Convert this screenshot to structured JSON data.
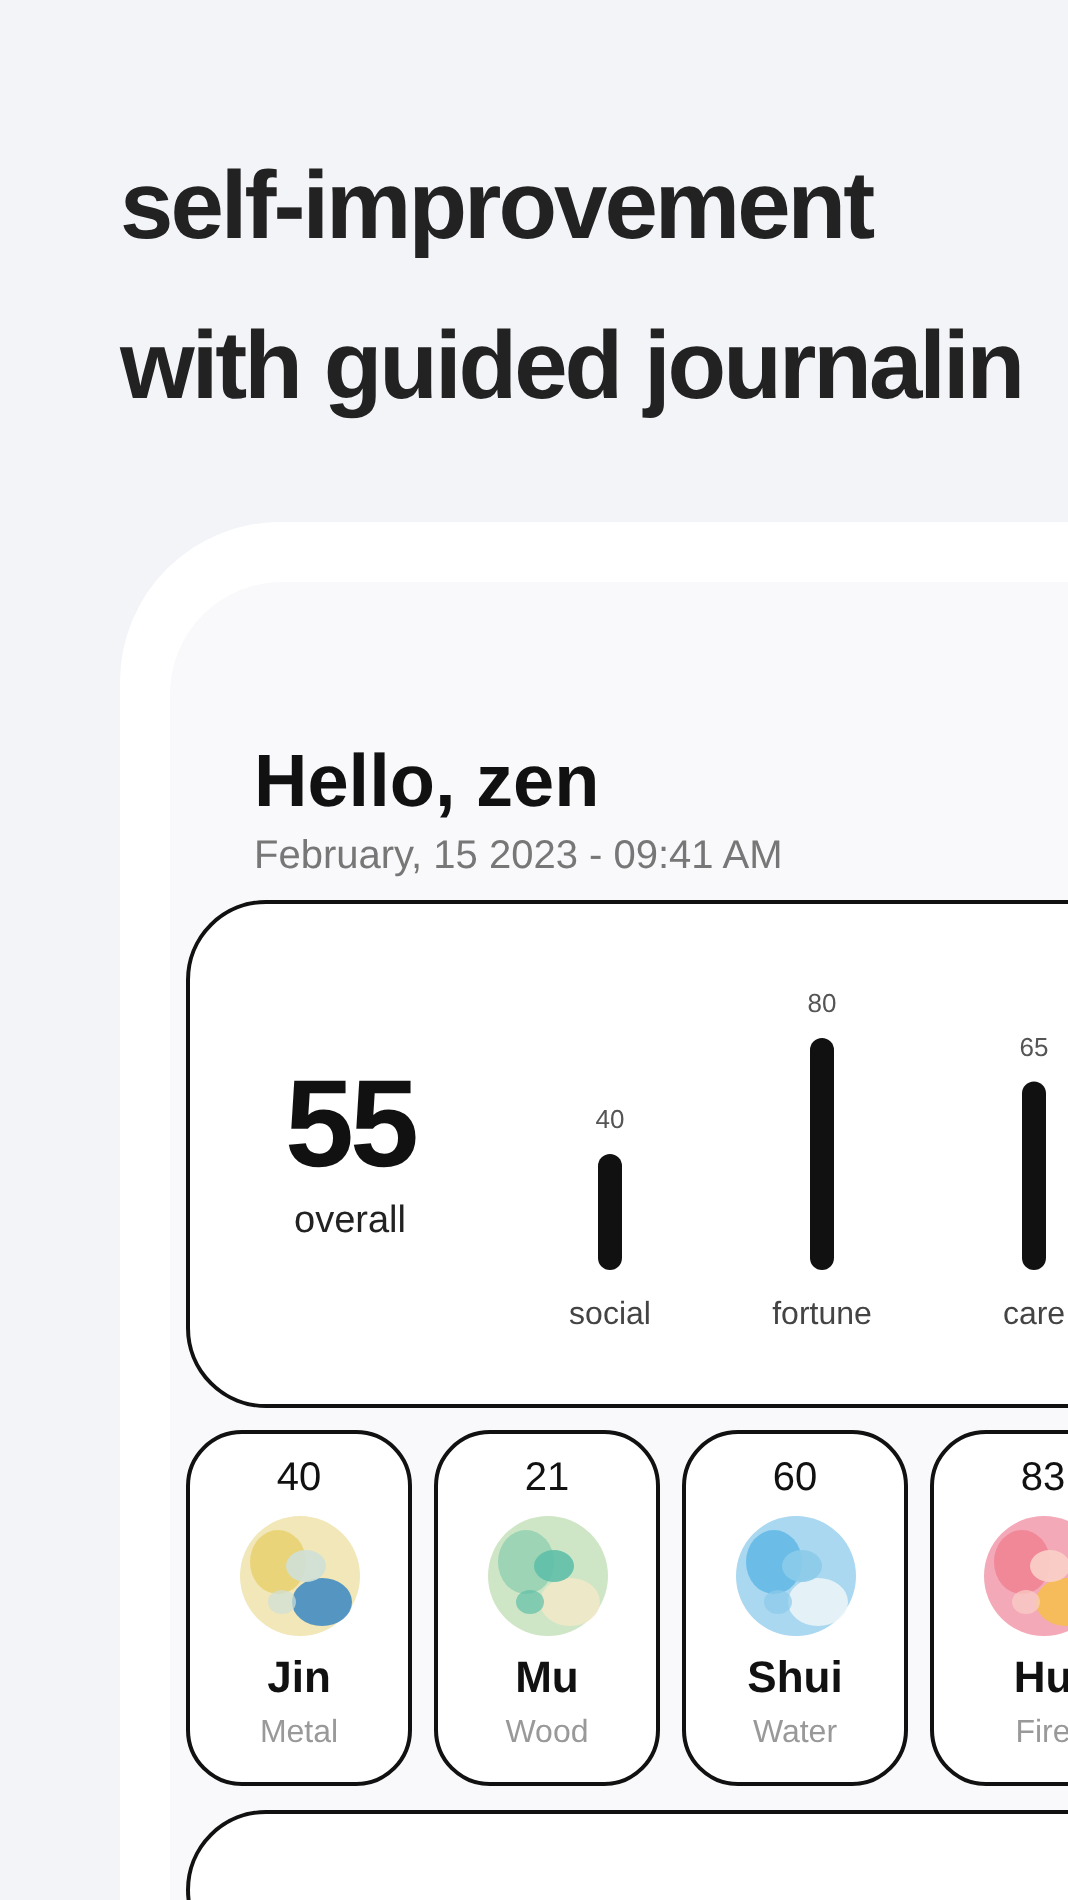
{
  "headline": [
    "self-improvement",
    "with guided journalin"
  ],
  "greeting": {
    "title": "Hello, zen",
    "date": "February, 15 2023 - 09:41 AM"
  },
  "score": {
    "value": "55",
    "label": "overall",
    "chart_data": {
      "type": "bar",
      "categories": [
        "social",
        "fortune",
        "care"
      ],
      "values": [
        40,
        80,
        65
      ],
      "data_labels": true
    }
  },
  "elements": [
    {
      "score": "40",
      "name": "Jin",
      "meaning": "Metal"
    },
    {
      "score": "21",
      "name": "Mu",
      "meaning": "Wood"
    },
    {
      "score": "60",
      "name": "Shui",
      "meaning": "Water"
    },
    {
      "score": "83",
      "name": "Hu",
      "meaning": "Fire"
    }
  ]
}
